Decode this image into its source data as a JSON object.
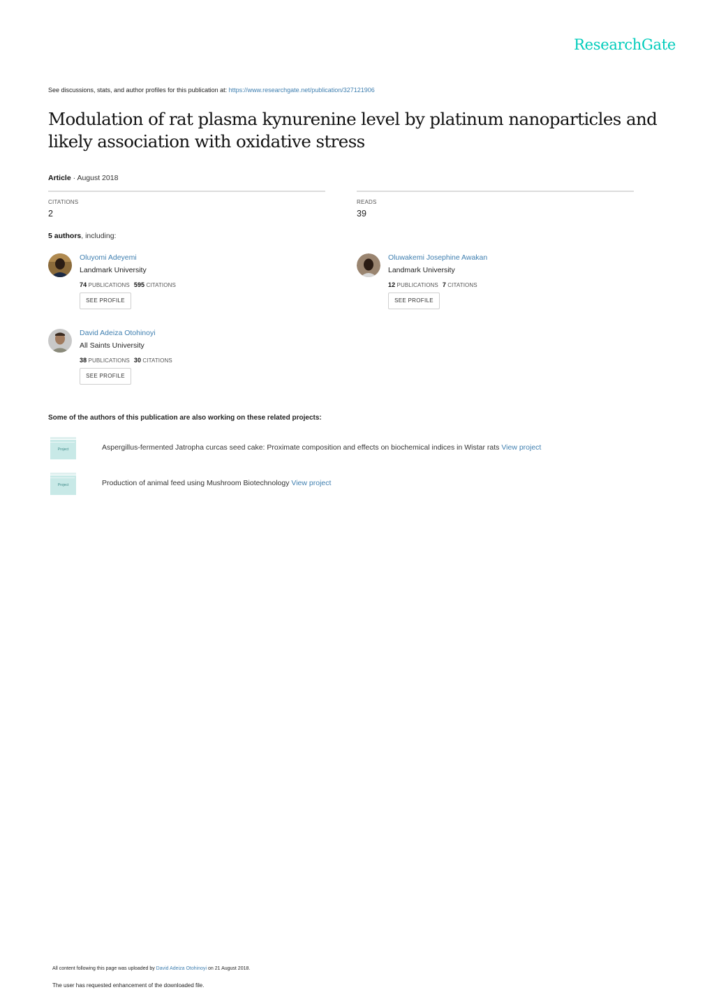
{
  "brand": {
    "logo_text": "ResearchGate",
    "color": "#00ccbb"
  },
  "header": {
    "see_text": "See discussions, stats, and author profiles for this publication at: ",
    "url": "https://www.researchgate.net/publication/327121906"
  },
  "publication": {
    "title": "Modulation of rat plasma kynurenine level by platinum nanoparticles and likely association with oxidative stress",
    "type": "Article",
    "separator": " · ",
    "date": "August 2018"
  },
  "stats": {
    "citations_label": "CITATIONS",
    "citations_value": "2",
    "reads_label": "READS",
    "reads_value": "39"
  },
  "authors_summary": {
    "count": "5 authors",
    "suffix": ", including:"
  },
  "authors": [
    {
      "name": "Oluyomi Adeyemi",
      "institution": "Landmark University",
      "publications": "74",
      "publications_label": "PUBLICATIONS",
      "citations": "595",
      "citations_label": "CITATIONS",
      "button": "SEE PROFILE"
    },
    {
      "name": "Oluwakemi Josephine Awakan",
      "institution": "Landmark University",
      "publications": "12",
      "publications_label": "PUBLICATIONS",
      "citations": "7",
      "citations_label": "CITATIONS",
      "button": "SEE PROFILE"
    },
    {
      "name": "David Adeiza Otohinoyi",
      "institution": "All Saints University",
      "publications": "38",
      "publications_label": "PUBLICATIONS",
      "citations": "30",
      "citations_label": "CITATIONS",
      "button": "SEE PROFILE"
    }
  ],
  "projects": {
    "heading": "Some of the authors of this publication are also working on these related projects:",
    "icon_label": "Project",
    "items": [
      {
        "title": "Aspergillus-fermented Jatropha curcas seed cake: Proximate composition and effects on biochemical indices in Wistar rats ",
        "link": "View project"
      },
      {
        "title": "Production of animal feed using Mushroom Biotechnology ",
        "link": "View project"
      }
    ]
  },
  "footer": {
    "upload_prefix": "All content following this page was uploaded by ",
    "uploader": "David Adeiza Otohinoyi",
    "upload_suffix": " on 21 August 2018.",
    "enhancement_note": "The user has requested enhancement of the downloaded file."
  }
}
